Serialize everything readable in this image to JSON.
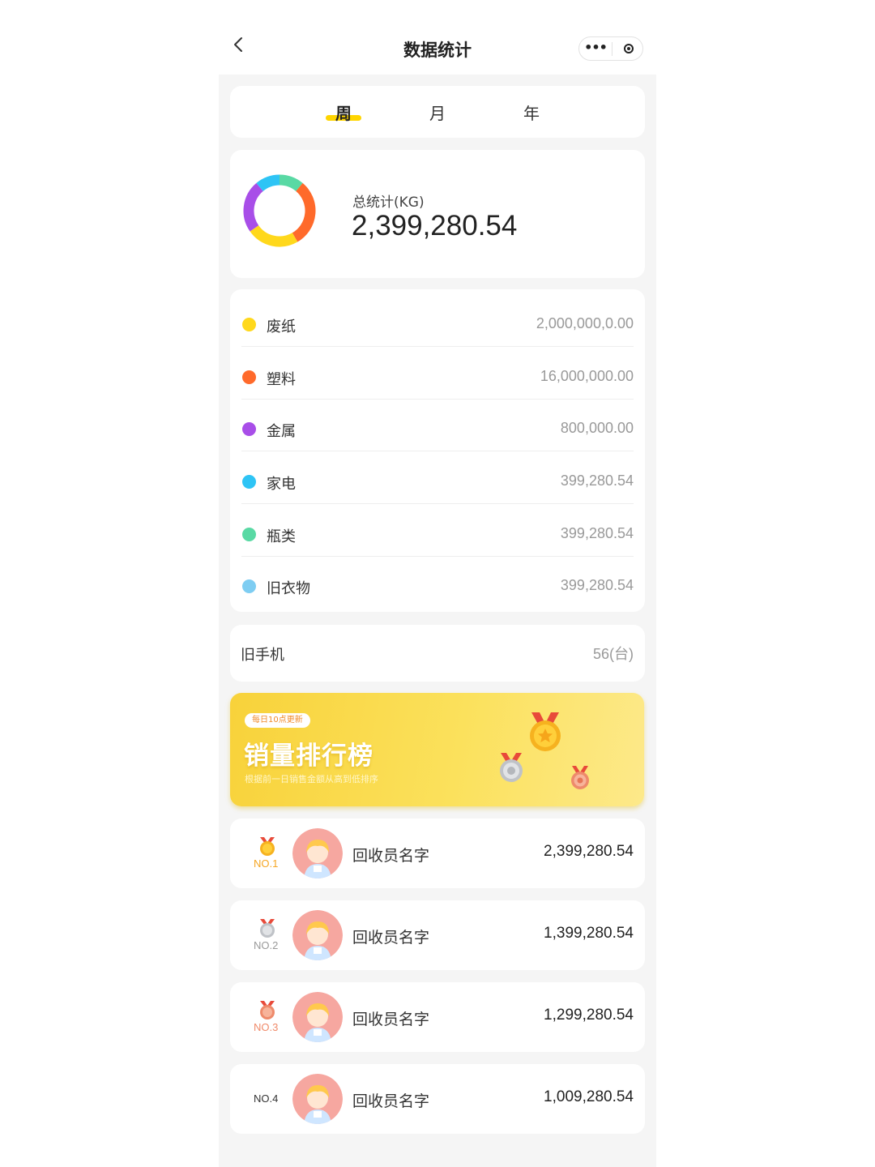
{
  "navbar": {
    "title": "数据统计",
    "more_icon": "•••"
  },
  "tabs": [
    {
      "label": "周",
      "active": true
    },
    {
      "label": "月",
      "active": false
    },
    {
      "label": "年",
      "active": false
    }
  ],
  "summary": {
    "label": "总统计(KG)",
    "value": "2,399,280.54",
    "donut_colors": [
      "#ffd81c",
      "#ff6a2b",
      "#a84ee8",
      "#2ec4f5",
      "#59d9a4",
      "#7ecdf2"
    ]
  },
  "categories": [
    {
      "name": "废纸",
      "value": "2,000,000,0.00",
      "color": "#ffd81c"
    },
    {
      "name": "塑料",
      "value": "16,000,000.00",
      "color": "#ff6a2b"
    },
    {
      "name": "金属",
      "value": "800,000.00",
      "color": "#a84ee8"
    },
    {
      "name": "家电",
      "value": "399,280.54",
      "color": "#2ec4f5"
    },
    {
      "name": "瓶类",
      "value": "399,280.54",
      "color": "#59d9a4"
    },
    {
      "name": "旧衣物",
      "value": "399,280.54",
      "color": "#7ecdf2"
    }
  ],
  "old_phone": {
    "name": "旧手机",
    "value": "56(台)"
  },
  "banner": {
    "badge": "每日10点更新",
    "title": "销量排行榜",
    "subtitle": "根据前一日销售金额从高到低排序"
  },
  "ranking": [
    {
      "rank": "NO.1",
      "name": "回收员名字",
      "value": "2,399,280.54",
      "medal": "gold",
      "rank_color": "#f5a623"
    },
    {
      "rank": "NO.2",
      "name": "回收员名字",
      "value": "1,399,280.54",
      "medal": "silver",
      "rank_color": "#999999"
    },
    {
      "rank": "NO.3",
      "name": "回收员名字",
      "value": "1,299,280.54",
      "medal": "bronze",
      "rank_color": "#f08a6a"
    },
    {
      "rank": "NO.4",
      "name": "回收员名字",
      "value": "1,009,280.54",
      "medal": "none",
      "rank_color": "#333333"
    }
  ]
}
